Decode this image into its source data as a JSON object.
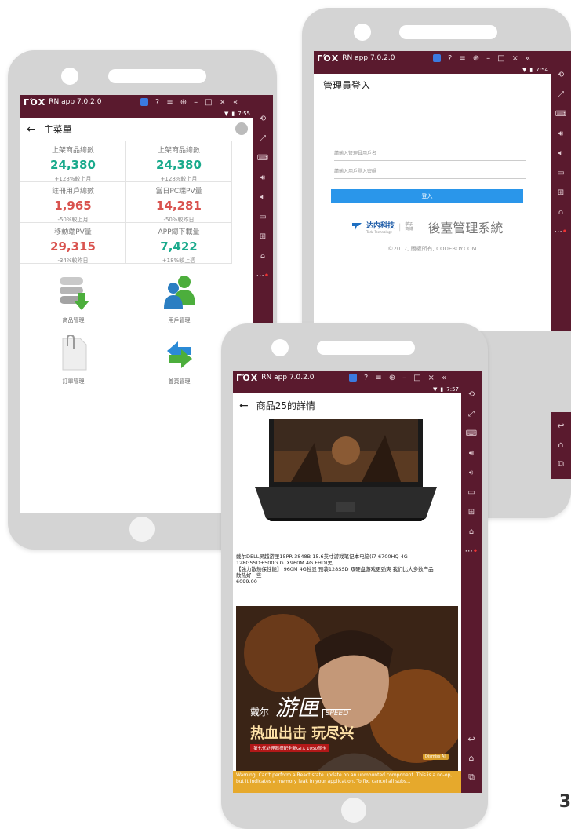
{
  "window": {
    "brand": "ΓΌΧ",
    "title": "RN app 7.0.2.0",
    "controls": [
      "?",
      "≡",
      "⊕",
      "–",
      "□",
      "×",
      "«"
    ]
  },
  "phone1": {
    "time": "7:55",
    "header": "主菜單",
    "stats": [
      {
        "label": "上架商品總數",
        "value": "24,380",
        "sub": "+128%較上月",
        "color": "#1aaa8c"
      },
      {
        "label": "上架商品總數",
        "value": "24,380",
        "sub": "+128%較上月",
        "color": "#1aaa8c"
      },
      {
        "label": "註冊用戶總數",
        "value": "1,965",
        "sub": "-50%較上月",
        "color": "#d9534f"
      },
      {
        "label": "當日PC端PV量",
        "value": "14,281",
        "sub": "-50%較昨日",
        "color": "#d9534f"
      },
      {
        "label": "移動端PV量",
        "value": "29,315",
        "sub": "-34%較昨日",
        "color": "#d9534f"
      },
      {
        "label": "APP總下載量",
        "value": "7,422",
        "sub": "+18%較上週",
        "color": "#1aaa8c"
      }
    ],
    "menu": [
      {
        "label": "商品管理",
        "icon": "database-download-icon"
      },
      {
        "label": "用戶管理",
        "icon": "users-icon"
      },
      {
        "label": "訂單管理",
        "icon": "document-clip-icon"
      },
      {
        "label": "首頁管理",
        "icon": "refresh-arrows-icon"
      }
    ]
  },
  "phone2": {
    "time": "7:54",
    "header": "管理員登入",
    "username_placeholder": "請輸入管理員用戶名",
    "password_placeholder": "請輸入用戶登入密碼",
    "login_button": "登入",
    "company": "达内科技",
    "company_en": "Tedu Technology",
    "company_sub": "学子 商城",
    "system_name": "後臺管理系統",
    "copyright": "©2017, 版權所有, CODEBOY.COM"
  },
  "phone3": {
    "time": "7:57",
    "header": "商品25的詳情",
    "title_line1": "戴尔DELL灵越游匣15PR-3848B 15.6英寸游戏笔记本电脑(i7-6700HQ 4G",
    "title_line2": "128GSSD+500G GTX960M 4G FHD)黑",
    "promo_line1": "【強力散熱保性能】 960M 4G独显 预装128SSD 双硬盘游戏更劲爽 我们比大多数产品",
    "promo_line2": "散热好一些",
    "price": "6099.00",
    "banner_brand": "戴尔",
    "banner_series": "游匣",
    "banner_speed": "SPEED",
    "banner_slogan": "热血出击 玩尽兴",
    "banner_sub": "第七代处理器搭配全新GTX 1050显卡",
    "banner_action": "Dismiss All",
    "warning": "Warning: Can't perform a React state update on an unmounted component. This is a no-op, but it indicates a memory leak in your application. To fix, cancel all subs..."
  },
  "page_number": "3"
}
